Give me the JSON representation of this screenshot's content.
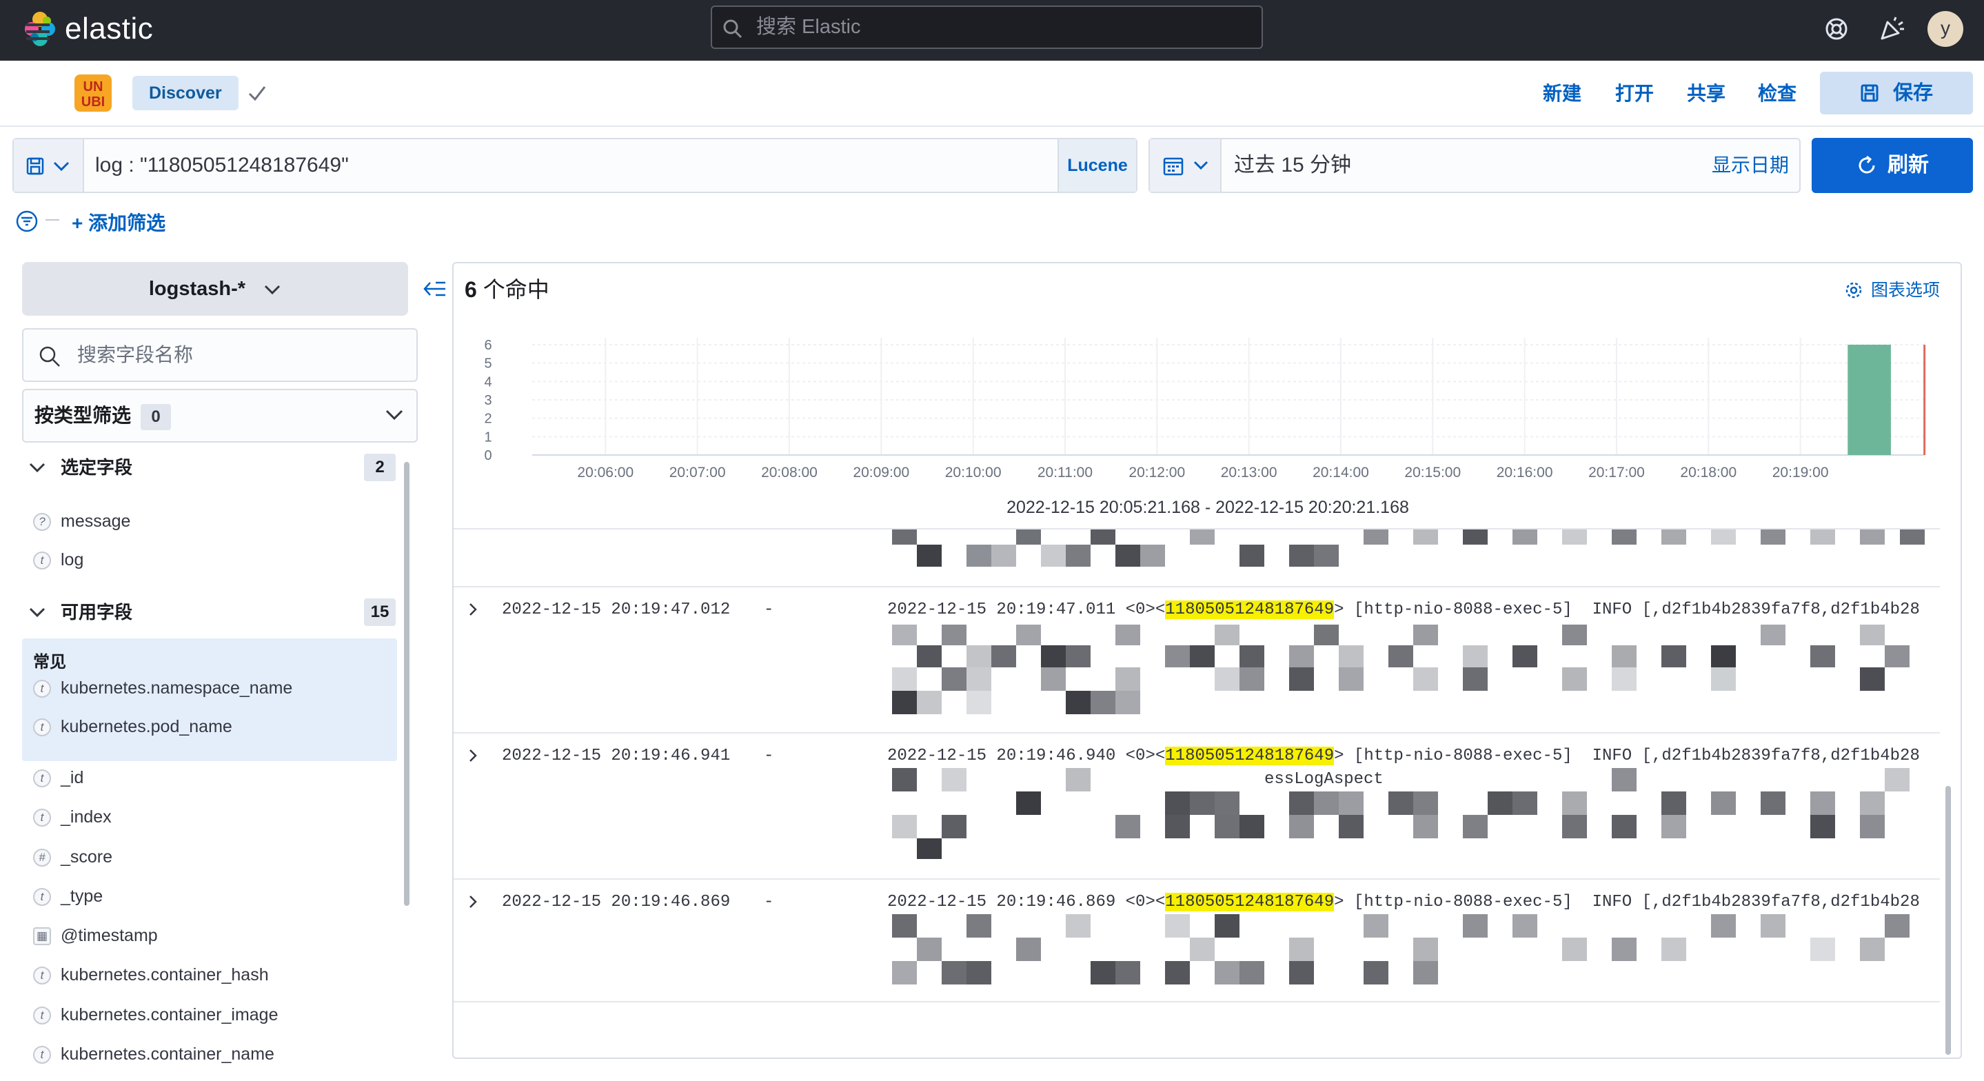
{
  "header": {
    "logo_text": "elastic",
    "search_placeholder": "搜索 Elastic",
    "avatar_initial": "y",
    "icons": [
      "help-icon",
      "newsfeed-icon"
    ]
  },
  "appbar": {
    "space_badge": "UNUBI",
    "breadcrumb": "Discover",
    "links": {
      "new": "新建",
      "open": "打开",
      "share": "共享",
      "inspect": "检查"
    },
    "save_label": "保存"
  },
  "query": {
    "text": "log : \"11805051248187649\"",
    "language": "Lucene"
  },
  "time": {
    "range_text": "过去 15 分钟",
    "show_dates": "显示日期",
    "refresh_label": "刷新"
  },
  "filters": {
    "add_label": "+ 添加筛选"
  },
  "sidebar": {
    "index_pattern": "logstash-*",
    "field_search_placeholder": "搜索字段名称",
    "type_filter_label": "按类型筛选",
    "type_filter_count": "0",
    "selected": {
      "title": "选定字段",
      "count": "2",
      "fields": [
        {
          "name": "message",
          "type": "?"
        },
        {
          "name": "log",
          "type": "t"
        }
      ]
    },
    "available": {
      "title": "可用字段",
      "count": "15",
      "common_label": "常见",
      "common_fields": [
        {
          "name": "kubernetes.namespace_name",
          "type": "t"
        },
        {
          "name": "kubernetes.pod_name",
          "type": "t"
        }
      ],
      "fields": [
        {
          "name": "_id",
          "type": "t"
        },
        {
          "name": "_index",
          "type": "t"
        },
        {
          "name": "_score",
          "type": "#"
        },
        {
          "name": "_type",
          "type": "t"
        },
        {
          "name": "@timestamp",
          "type": "▦"
        },
        {
          "name": "kubernetes.container_hash",
          "type": "t"
        },
        {
          "name": "kubernetes.container_image",
          "type": "t"
        },
        {
          "name": "kubernetes.container_name",
          "type": "t"
        }
      ]
    }
  },
  "results": {
    "hits_count": "6",
    "hits_suffix": " 个命中",
    "chart_options_label": "图表选项",
    "range_label": "2022-12-15 20:05:21.168 - 2022-12-15 20:20:21.168",
    "docs": [
      {
        "timestamp": "2022-12-15 20:19:47.012",
        "sep": "-",
        "prefix": "2022-12-15 20:19:47.011 <0><",
        "id": "11805051248187649",
        "suffix": "> [http-nio-8088-exec-5]  INFO [,d2f1b4b2839fa7f8,d2f1b4b28"
      },
      {
        "timestamp": "2022-12-15 20:19:46.941",
        "sep": "-",
        "prefix": "2022-12-15 20:19:46.940 <0><",
        "id": "11805051248187649",
        "suffix": "> [http-nio-8088-exec-5]  INFO [,d2f1b4b2839fa7f8,d2f1b4b28",
        "extra_text": "essLogAspect"
      },
      {
        "timestamp": "2022-12-15 20:19:46.869",
        "sep": "-",
        "prefix": "2022-12-15 20:19:46.869 <0><",
        "id": "11805051248187649",
        "suffix": "> [http-nio-8088-exec-5]  INFO [,d2f1b4b2839fa7f8,d2f1b4b28"
      }
    ]
  },
  "chart_data": {
    "type": "bar",
    "title": "",
    "xlabel": "2022-12-15 20:05:21.168 - 2022-12-15 20:20:21.168",
    "ylabel": "",
    "y_ticks": [
      "0",
      "1",
      "2",
      "3",
      "4",
      "5",
      "6"
    ],
    "ylim": [
      0,
      6
    ],
    "x_ticks": [
      "20:06:00",
      "20:07:00",
      "20:08:00",
      "20:09:00",
      "20:10:00",
      "20:11:00",
      "20:12:00",
      "20:13:00",
      "20:14:00",
      "20:15:00",
      "20:16:00",
      "20:17:00",
      "20:18:00",
      "20:19:00"
    ],
    "bars": [
      {
        "x": "20:19:30",
        "value": 6
      }
    ],
    "now_marker": "20:20:21",
    "bar_color": "#6db69a",
    "now_color": "#e0695b",
    "grid": true
  },
  "colors": {
    "header_bg": "#25282f",
    "accent": "#0061c2",
    "primary_button": "#0b64d2",
    "highlight": "#f7f000"
  }
}
